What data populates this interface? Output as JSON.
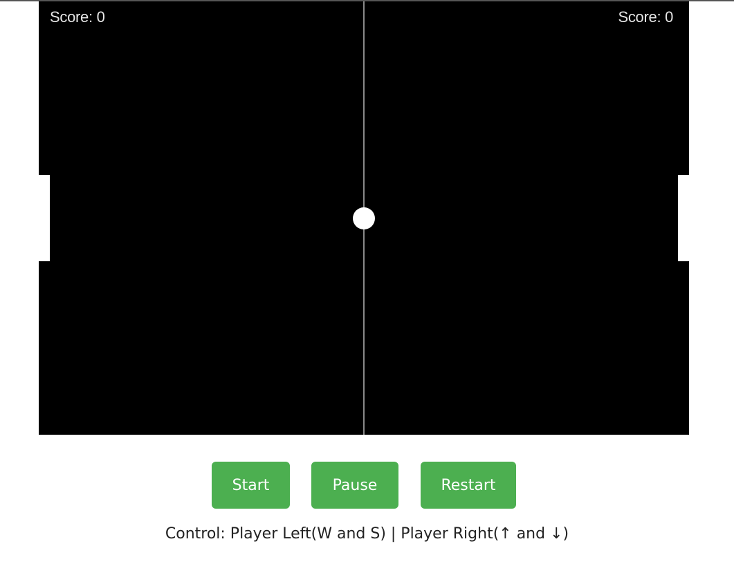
{
  "scoreboard": {
    "left_score_label": "Score: 0",
    "right_score_label": "Score: 0"
  },
  "game_state": {
    "left_score": 0,
    "right_score": 0
  },
  "buttons": {
    "start_label": "Start",
    "pause_label": "Pause",
    "restart_label": "Restart"
  },
  "instructions": {
    "text": "Control: Player Left(W and S) | Player Right(↑ and ↓)"
  },
  "colors": {
    "canvas_background": "#000000",
    "button_background": "#4caf50",
    "paddle": "#ffffff",
    "ball": "#ffffff",
    "center_line": "#8a8a8a"
  }
}
